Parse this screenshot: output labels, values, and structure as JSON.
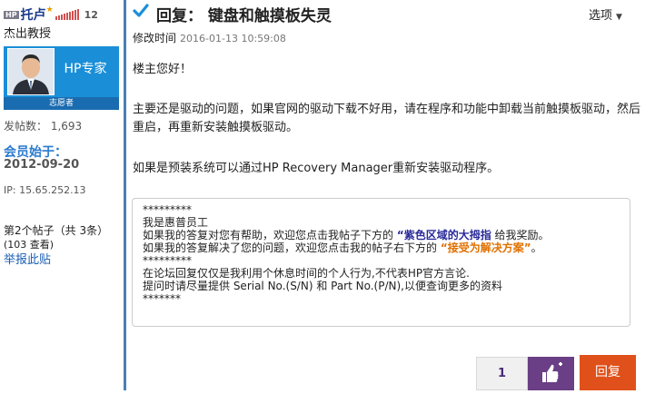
{
  "author": {
    "badge": "HP",
    "name": "托卢",
    "kudos": "12",
    "title": "杰出教授",
    "card_label": "HP专家",
    "rank": "志愿者",
    "posts": "发帖数：  1,693",
    "join_label": "会员始于：",
    "join_date": "2012-09-20",
    "ip": "IP: 15.65.252.13",
    "post_index": "第2个帖子（共 3条）",
    "views": "(103 查看)",
    "report": "举报此贴"
  },
  "post": {
    "title": "回复：  键盘和触摸板失灵",
    "options": "选项",
    "modified_label": "修改时间",
    "modified_date": "2016-01-13 10:59:08",
    "greeting": "楼主您好！",
    "para1": "主要还是驱动的问题，如果官网的驱动下载不好用，请在程序和功能中卸载当前触摸板驱动，然后重启，再重新安装触摸板驱动。",
    "para2": "如果是预装系统可以通过HP Recovery Manager重新安装驱动程序。"
  },
  "signature": {
    "stars1": "*********",
    "line1": "我是惠普员工",
    "line2_pre": "如果我的答复对您有帮助，欢迎您点击我帖子下方的 ",
    "line2_highlight": "“紫色区域的大拇指",
    "line2_post": " 给我奖励。",
    "line3_pre": "如果我的答复解决了您的问题，欢迎您点击我的帖子右下方的 ",
    "line3_highlight": "“接受为解决方案”",
    "line3_post": "。",
    "stars2": "*********",
    "line4": "在论坛回复仅仅是我利用个休息时间的个人行为,不代表HP官方言论.",
    "line5": "提问时请尽量提供 Serial No.(S/N) 和 Part No.(P/N),以便查询更多的资料",
    "stars3": "*******"
  },
  "actions": {
    "kudos_count": "1",
    "reply_label": "回复"
  },
  "icons": {
    "check": "checkmark-icon",
    "thumbs_up": "thumbs-up-plus-icon",
    "caret": "chevron-down-icon"
  },
  "colors": {
    "accent_blue": "#1a8fd8",
    "kudos_purple": "#6a3f86",
    "reply_orange": "#e0501a"
  }
}
